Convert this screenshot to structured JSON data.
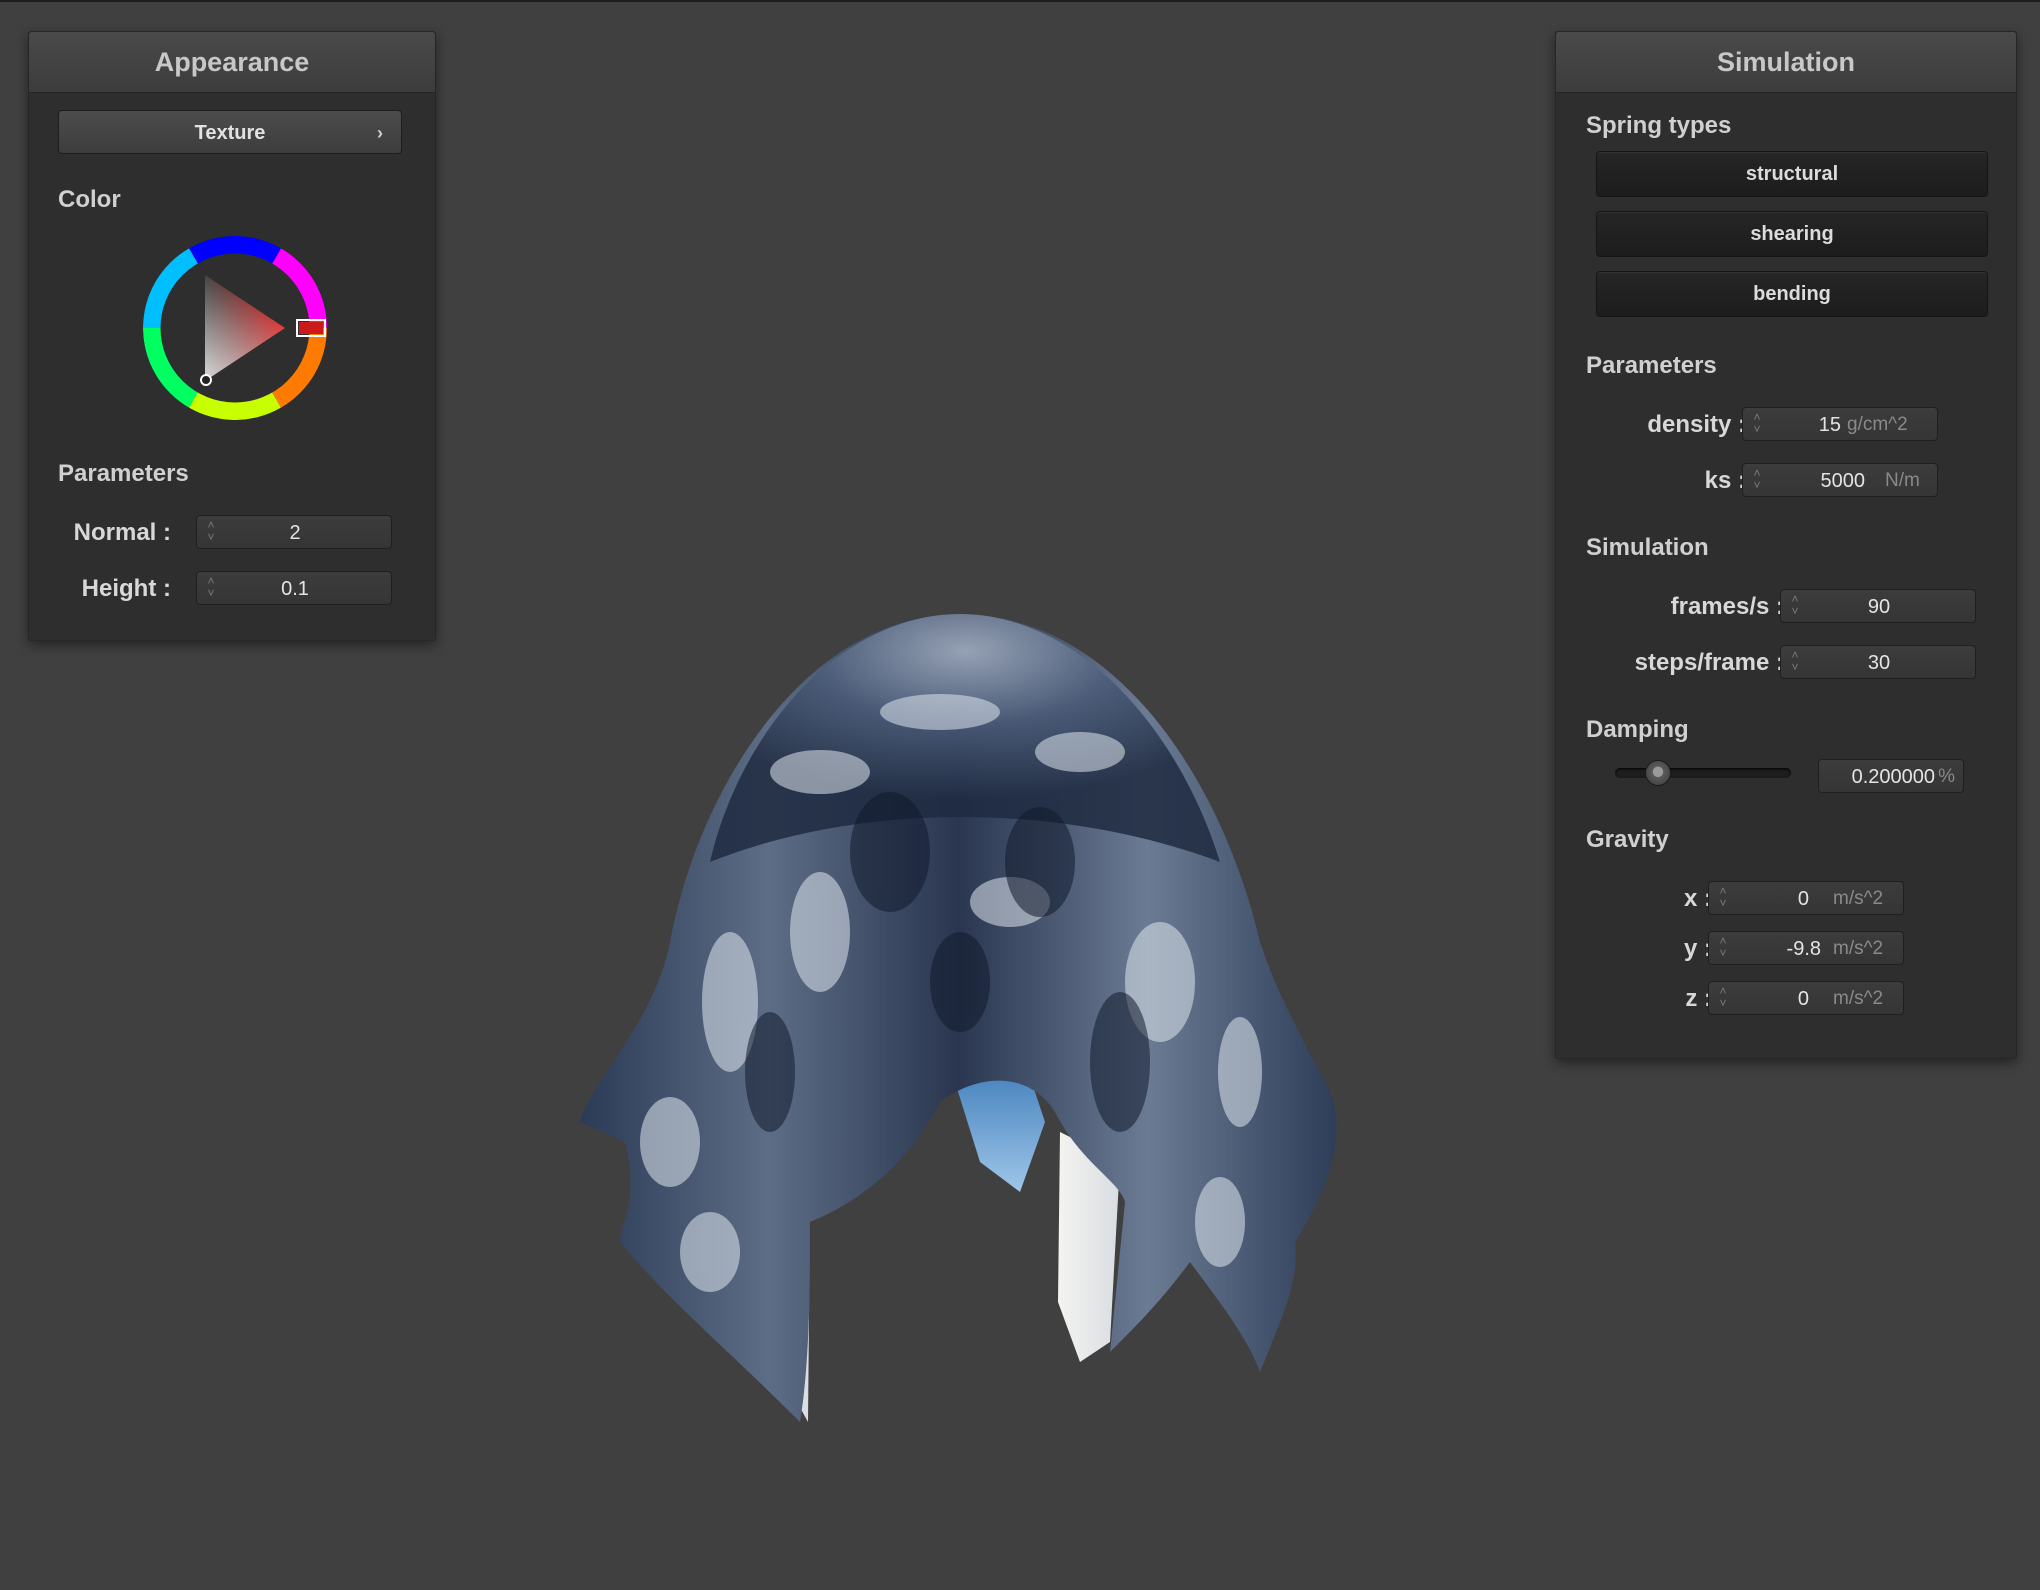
{
  "appearance": {
    "title": "Appearance",
    "texture_button": "Texture",
    "chevron": "›",
    "color_label": "Color",
    "color_value": "#cc1a1a",
    "parameters_label": "Parameters",
    "normal": {
      "label": "Normal :",
      "value": "2"
    },
    "height": {
      "label": "Height :",
      "value": "0.1"
    }
  },
  "simulation": {
    "title": "Simulation",
    "spring_types_label": "Spring types",
    "spring_types": [
      "structural",
      "shearing",
      "bending"
    ],
    "parameters_label": "Parameters",
    "density": {
      "label": "density :",
      "value": "15",
      "unit": "g/cm^2"
    },
    "ks": {
      "label": "ks :",
      "value": "5000",
      "unit": "N/m"
    },
    "simulation_label": "Simulation",
    "frames": {
      "label": "frames/s :",
      "value": "90"
    },
    "steps": {
      "label": "steps/frame :",
      "value": "30"
    },
    "damping_label": "Damping",
    "damping": {
      "value": "0.200000",
      "unit": "%",
      "slider_fraction": 0.2
    },
    "gravity_label": "Gravity",
    "gravity": {
      "x": {
        "label": "x :",
        "value": "0",
        "unit": "m/s^2"
      },
      "y": {
        "label": "y :",
        "value": "-9.8",
        "unit": "m/s^2"
      },
      "z": {
        "label": "z :",
        "value": "0",
        "unit": "m/s^2"
      }
    }
  },
  "viewport": {
    "background": "#404040",
    "object": "cloth draped over sphere"
  }
}
